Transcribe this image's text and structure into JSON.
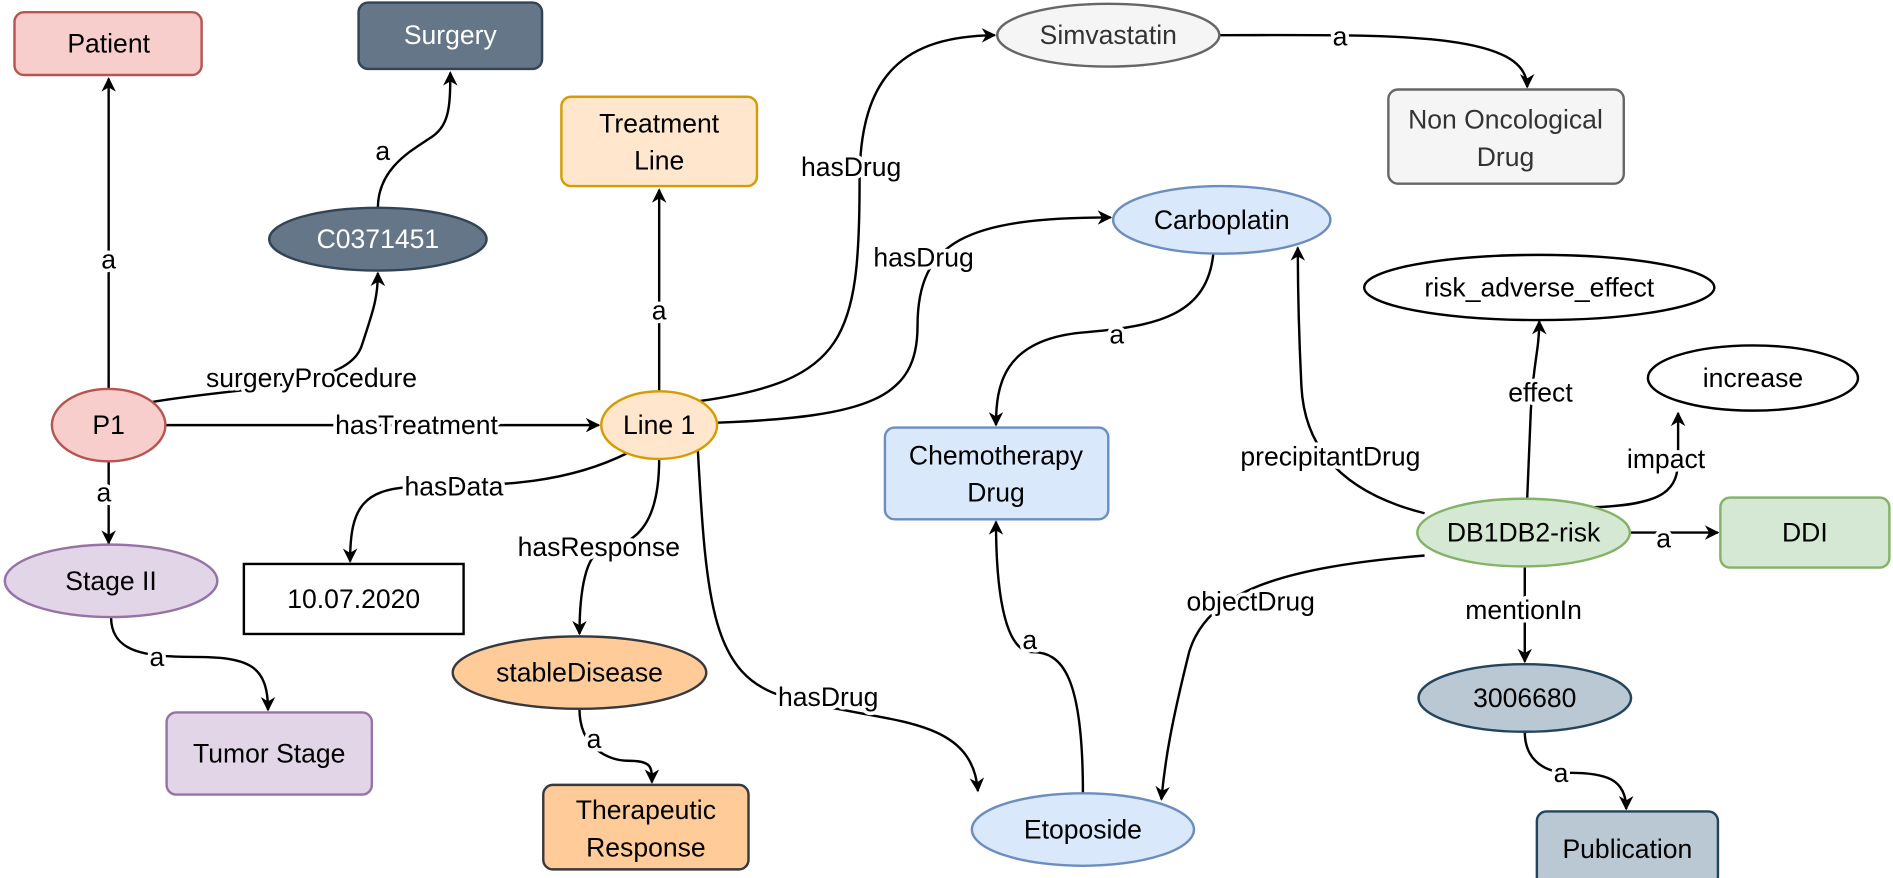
{
  "nodes": {
    "patient": "Patient",
    "surgery": "Surgery",
    "c0371451": "C0371451",
    "p1": "P1",
    "stage_ii": "Stage II",
    "tumor_stage": "Tumor Stage",
    "treatment_line": [
      "Treatment",
      "Line"
    ],
    "line1": "Line 1",
    "date": "10.07.2020",
    "stable_disease": "stableDisease",
    "therapeutic_response": [
      "Therapeutic",
      "Response"
    ],
    "simvastatin": "Simvastatin",
    "non_oncological_drug": [
      "Non Oncological",
      "Drug"
    ],
    "carboplatin": "Carboplatin",
    "chemotherapy_drug": [
      "Chemotherapy",
      "Drug"
    ],
    "etoposide": "Etoposide",
    "risk_adverse_effect": "risk_adverse_effect",
    "increase": "increase",
    "db1db2_risk": "DB1DB2-risk",
    "ddi": "DDI",
    "pub_id": "3006680",
    "publication": "Publication"
  },
  "edges": {
    "p1_patient": "a",
    "p1_surgery_proc": "surgeryProcedure",
    "c_surgery": "a",
    "p1_treatment": "hasTreatment",
    "p1_stage": "a",
    "stage_tumor": "a",
    "line_treatment": "a",
    "line_simva": "hasDrug",
    "line_carbo": "hasDrug",
    "line_data": "hasData",
    "line_response": "hasResponse",
    "line_etoposide": "hasDrug",
    "stable_therapeutic": "a",
    "simva_nononc": "a",
    "carbo_chemo": "a",
    "etoposide_chemo": "a",
    "risk_carbo": "precipitantDrug",
    "risk_etoposide": "objectDrug",
    "risk_effect": "effect",
    "risk_impact": "impact",
    "risk_ddi": "a",
    "risk_mention": "mentionIn",
    "pub_a": "a"
  },
  "colors": {
    "red": [
      "#f8cecc",
      "#b85450"
    ],
    "slate": [
      "#647687",
      "#314354"
    ],
    "orange_light": [
      "#ffe6cc",
      "#d79b00"
    ],
    "orange": [
      "#ffcc99",
      "#36393d"
    ],
    "gray": [
      "#f5f5f5",
      "#666666"
    ],
    "blue": [
      "#dae8fc",
      "#6c8ebf"
    ],
    "green": [
      "#d5e8d4",
      "#82b366"
    ],
    "purple": [
      "#e1d5e7",
      "#9673a6"
    ],
    "steel": [
      "#bac8d3",
      "#23445d"
    ]
  }
}
